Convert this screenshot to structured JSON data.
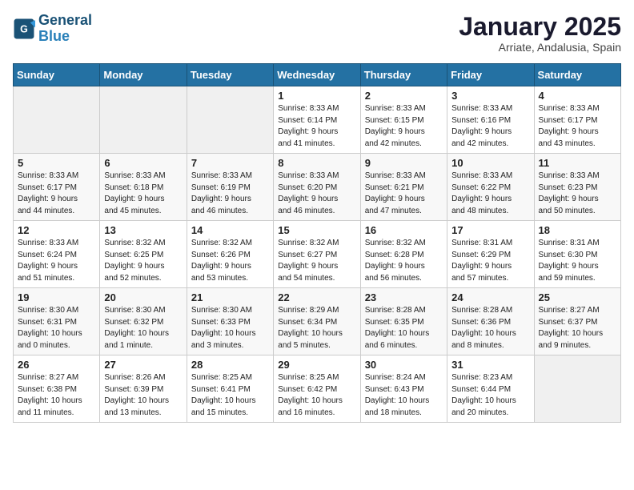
{
  "header": {
    "logo_line1": "General",
    "logo_line2": "Blue",
    "title": "January 2025",
    "subtitle": "Arriate, Andalusia, Spain"
  },
  "weekdays": [
    "Sunday",
    "Monday",
    "Tuesday",
    "Wednesday",
    "Thursday",
    "Friday",
    "Saturday"
  ],
  "weeks": [
    [
      {
        "num": "",
        "info": ""
      },
      {
        "num": "",
        "info": ""
      },
      {
        "num": "",
        "info": ""
      },
      {
        "num": "1",
        "info": "Sunrise: 8:33 AM\nSunset: 6:14 PM\nDaylight: 9 hours\nand 41 minutes."
      },
      {
        "num": "2",
        "info": "Sunrise: 8:33 AM\nSunset: 6:15 PM\nDaylight: 9 hours\nand 42 minutes."
      },
      {
        "num": "3",
        "info": "Sunrise: 8:33 AM\nSunset: 6:16 PM\nDaylight: 9 hours\nand 42 minutes."
      },
      {
        "num": "4",
        "info": "Sunrise: 8:33 AM\nSunset: 6:17 PM\nDaylight: 9 hours\nand 43 minutes."
      }
    ],
    [
      {
        "num": "5",
        "info": "Sunrise: 8:33 AM\nSunset: 6:17 PM\nDaylight: 9 hours\nand 44 minutes."
      },
      {
        "num": "6",
        "info": "Sunrise: 8:33 AM\nSunset: 6:18 PM\nDaylight: 9 hours\nand 45 minutes."
      },
      {
        "num": "7",
        "info": "Sunrise: 8:33 AM\nSunset: 6:19 PM\nDaylight: 9 hours\nand 46 minutes."
      },
      {
        "num": "8",
        "info": "Sunrise: 8:33 AM\nSunset: 6:20 PM\nDaylight: 9 hours\nand 46 minutes."
      },
      {
        "num": "9",
        "info": "Sunrise: 8:33 AM\nSunset: 6:21 PM\nDaylight: 9 hours\nand 47 minutes."
      },
      {
        "num": "10",
        "info": "Sunrise: 8:33 AM\nSunset: 6:22 PM\nDaylight: 9 hours\nand 48 minutes."
      },
      {
        "num": "11",
        "info": "Sunrise: 8:33 AM\nSunset: 6:23 PM\nDaylight: 9 hours\nand 50 minutes."
      }
    ],
    [
      {
        "num": "12",
        "info": "Sunrise: 8:33 AM\nSunset: 6:24 PM\nDaylight: 9 hours\nand 51 minutes."
      },
      {
        "num": "13",
        "info": "Sunrise: 8:32 AM\nSunset: 6:25 PM\nDaylight: 9 hours\nand 52 minutes."
      },
      {
        "num": "14",
        "info": "Sunrise: 8:32 AM\nSunset: 6:26 PM\nDaylight: 9 hours\nand 53 minutes."
      },
      {
        "num": "15",
        "info": "Sunrise: 8:32 AM\nSunset: 6:27 PM\nDaylight: 9 hours\nand 54 minutes."
      },
      {
        "num": "16",
        "info": "Sunrise: 8:32 AM\nSunset: 6:28 PM\nDaylight: 9 hours\nand 56 minutes."
      },
      {
        "num": "17",
        "info": "Sunrise: 8:31 AM\nSunset: 6:29 PM\nDaylight: 9 hours\nand 57 minutes."
      },
      {
        "num": "18",
        "info": "Sunrise: 8:31 AM\nSunset: 6:30 PM\nDaylight: 9 hours\nand 59 minutes."
      }
    ],
    [
      {
        "num": "19",
        "info": "Sunrise: 8:30 AM\nSunset: 6:31 PM\nDaylight: 10 hours\nand 0 minutes."
      },
      {
        "num": "20",
        "info": "Sunrise: 8:30 AM\nSunset: 6:32 PM\nDaylight: 10 hours\nand 1 minute."
      },
      {
        "num": "21",
        "info": "Sunrise: 8:30 AM\nSunset: 6:33 PM\nDaylight: 10 hours\nand 3 minutes."
      },
      {
        "num": "22",
        "info": "Sunrise: 8:29 AM\nSunset: 6:34 PM\nDaylight: 10 hours\nand 5 minutes."
      },
      {
        "num": "23",
        "info": "Sunrise: 8:28 AM\nSunset: 6:35 PM\nDaylight: 10 hours\nand 6 minutes."
      },
      {
        "num": "24",
        "info": "Sunrise: 8:28 AM\nSunset: 6:36 PM\nDaylight: 10 hours\nand 8 minutes."
      },
      {
        "num": "25",
        "info": "Sunrise: 8:27 AM\nSunset: 6:37 PM\nDaylight: 10 hours\nand 9 minutes."
      }
    ],
    [
      {
        "num": "26",
        "info": "Sunrise: 8:27 AM\nSunset: 6:38 PM\nDaylight: 10 hours\nand 11 minutes."
      },
      {
        "num": "27",
        "info": "Sunrise: 8:26 AM\nSunset: 6:39 PM\nDaylight: 10 hours\nand 13 minutes."
      },
      {
        "num": "28",
        "info": "Sunrise: 8:25 AM\nSunset: 6:41 PM\nDaylight: 10 hours\nand 15 minutes."
      },
      {
        "num": "29",
        "info": "Sunrise: 8:25 AM\nSunset: 6:42 PM\nDaylight: 10 hours\nand 16 minutes."
      },
      {
        "num": "30",
        "info": "Sunrise: 8:24 AM\nSunset: 6:43 PM\nDaylight: 10 hours\nand 18 minutes."
      },
      {
        "num": "31",
        "info": "Sunrise: 8:23 AM\nSunset: 6:44 PM\nDaylight: 10 hours\nand 20 minutes."
      },
      {
        "num": "",
        "info": ""
      }
    ]
  ]
}
